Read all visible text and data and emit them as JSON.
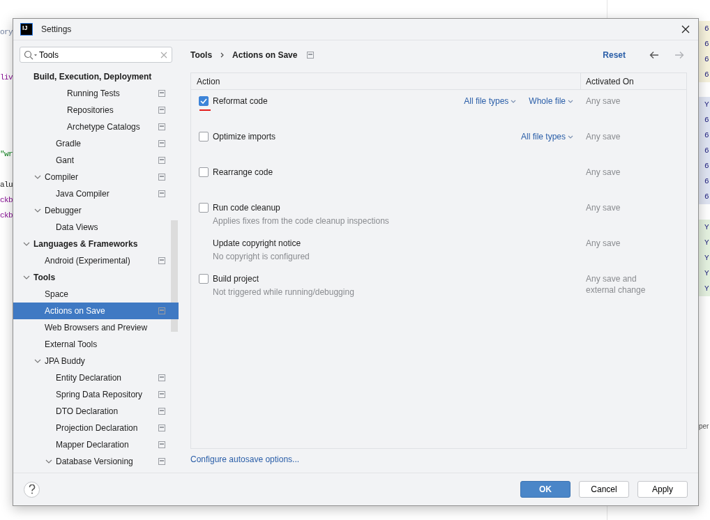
{
  "editor_left": [
    [
      {
        "text": "ory",
        "color": "#6f7f9e"
      }
    ],
    [
      {
        "text": "liv",
        "color": "#871094"
      }
    ],
    [
      {
        "text": "\"wr",
        "color": "#067d17"
      }
    ],
    [
      {
        "text": "alu",
        "color": "#222222"
      },
      {
        "text": "ckb",
        "color": "#871094"
      },
      {
        "text": "ckb",
        "color": "#871094"
      }
    ]
  ],
  "editor_right": {
    "blocks": [
      {
        "color": "#f6f2dc",
        "glyphs": [
          "6",
          "6",
          "6",
          "6"
        ]
      },
      {
        "color": "#dfe4f2",
        "glyphs": [
          "Y",
          "6",
          "6",
          "6",
          "6",
          "6",
          "6"
        ]
      },
      {
        "color": "#e4f1df",
        "glyphs": [
          "Y",
          "Y",
          "Y",
          "Y",
          "Y"
        ]
      }
    ],
    "fragment": "per"
  },
  "dialog": {
    "logo_text": "IJ",
    "title": "Settings"
  },
  "search": {
    "value": "Tools"
  },
  "tree": [
    {
      "label": "Build, Execution, Deployment",
      "project_scoped": false,
      "selected": false,
      "children": [
        {
          "children": [
            {
              "children": [
                {
                  "label": "Running Tests",
                  "project_scoped": true,
                  "selected": false
                },
                {
                  "label": "Repositories",
                  "project_scoped": true,
                  "selected": false
                },
                {
                  "label": "Archetype Catalogs",
                  "project_scoped": true,
                  "selected": false
                }
              ]
            },
            {
              "label": "Gradle",
              "project_scoped": true,
              "selected": false
            },
            {
              "label": "Gant",
              "project_scoped": true,
              "selected": false
            }
          ]
        },
        {
          "label": "Compiler",
          "project_scoped": true,
          "selected": false,
          "expanded": true,
          "children": [
            {
              "label": "Java Compiler",
              "project_scoped": true,
              "selected": false
            }
          ]
        },
        {
          "label": "Debugger",
          "project_scoped": false,
          "selected": false,
          "expanded": true,
          "children": [
            {
              "label": "Data Views",
              "project_scoped": false,
              "selected": false
            }
          ]
        }
      ]
    },
    {
      "label": "Languages & Frameworks",
      "project_scoped": false,
      "selected": false,
      "expanded": true,
      "children": [
        {
          "label": "Android (Experimental)",
          "project_scoped": true,
          "selected": false
        }
      ]
    },
    {
      "label": "Tools",
      "project_scoped": false,
      "selected": false,
      "expanded": true,
      "children": [
        {
          "label": "Space",
          "project_scoped": false,
          "selected": false
        },
        {
          "label": "Actions on Save",
          "project_scoped": true,
          "selected": true
        },
        {
          "label": "Web Browsers and Preview",
          "project_scoped": false,
          "selected": false
        },
        {
          "label": "External Tools",
          "project_scoped": false,
          "selected": false
        },
        {
          "label": "JPA Buddy",
          "project_scoped": false,
          "selected": false,
          "expanded": true,
          "children": [
            {
              "label": "Entity Declaration",
              "project_scoped": true,
              "selected": false
            },
            {
              "label": "Spring Data Repository",
              "project_scoped": true,
              "selected": false
            },
            {
              "label": "DTO Declaration",
              "project_scoped": true,
              "selected": false
            },
            {
              "label": "Projection Declaration",
              "project_scoped": true,
              "selected": false
            },
            {
              "label": "Mapper Declaration",
              "project_scoped": true,
              "selected": false
            },
            {
              "label": "Database Versioning",
              "project_scoped": true,
              "selected": false,
              "expanded": true
            }
          ]
        }
      ]
    }
  ],
  "breadcrumb": [
    "Tools",
    "Actions on Save"
  ],
  "reset": "Reset",
  "nav": {
    "back_disabled": false,
    "forward_disabled": true
  },
  "table": {
    "columns": [
      "Action",
      "Activated On"
    ],
    "rows": [
      {
        "kind": "checkbox",
        "checked": true,
        "flagged": true,
        "label": "Reformat code",
        "options": [
          "All file types",
          "Whole file"
        ],
        "activated": "Any save"
      },
      {
        "kind": "checkbox",
        "checked": false,
        "flagged": false,
        "label": "Optimize imports",
        "options": [
          "All file types"
        ],
        "activated": "Any save"
      },
      {
        "kind": "checkbox",
        "checked": false,
        "flagged": false,
        "label": "Rearrange code",
        "activated": "Any save"
      },
      {
        "kind": "checkbox",
        "checked": false,
        "flagged": false,
        "label": "Run code cleanup",
        "description": "Applies fixes from the code cleanup inspections",
        "activated": "Any save"
      },
      {
        "kind": "plain",
        "flagged": false,
        "label": "Update copyright notice",
        "description": "No copyright is configured",
        "activated": "Any save"
      },
      {
        "kind": "checkbox",
        "checked": false,
        "flagged": false,
        "label": "Build project",
        "description": "Not triggered while running/debugging",
        "activated": "Any save and external change"
      }
    ]
  },
  "autosave_link": "Configure autosave options...",
  "buttons": [
    {
      "label": "OK",
      "primary": true
    },
    {
      "label": "Cancel",
      "primary": false
    },
    {
      "label": "Apply",
      "primary": false
    }
  ]
}
